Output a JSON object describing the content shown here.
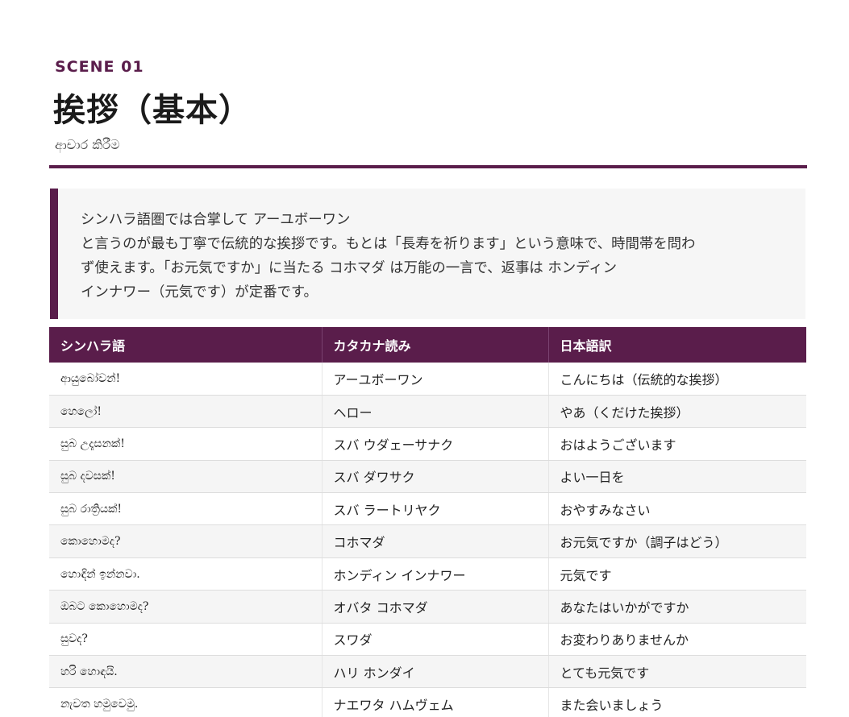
{
  "header": {
    "scene": "SCENE  01",
    "title": "挨拶（基本）",
    "subtitle": "ආචාර කිරීම"
  },
  "note": {
    "lines": [
      "シンハラ語圏では合掌して アーユボーワン",
      "と言うのが最も丁寧で伝統的な挨拶です。もとは「長寿を祈ります」という意味で、時間帯を問わ",
      "ず使えます。「お元気ですか」に当たる コホマダ は万能の一言で、返事は ホンディン",
      "インナワー（元気です）が定番です。"
    ]
  },
  "table": {
    "headers": [
      "シンハラ語",
      "カタカナ読み",
      "日本語訳"
    ],
    "rows": [
      [
        "ආයුබෝවන්!",
        "アーユボーワン",
        "こんにちは（伝統的な挨拶）"
      ],
      [
        "හෙලෝ!",
        "ヘロー",
        "やあ（くだけた挨拶）"
      ],
      [
        "සුබ උදෑසනක්!",
        "スバ ウダェーサナク",
        "おはようございます"
      ],
      [
        "සුබ දවසක්!",
        "スバ ダワサク",
        "よい一日を"
      ],
      [
        "සුබ රාත්‍රියක්!",
        "スバ ラートリヤク",
        "おやすみなさい"
      ],
      [
        "කොහොමද?",
        "コホマダ",
        "お元気ですか（調子はどう）"
      ],
      [
        "හොඳින් ඉන්නවා.",
        "ホンディン インナワー",
        "元気です"
      ],
      [
        "ඔබට කොහොමද?",
        "オバタ コホマダ",
        "あなたはいかがですか"
      ],
      [
        "සුවද?",
        "スワダ",
        "お変わりありませんか"
      ],
      [
        "හරි හොඳයි.",
        "ハリ ホンダイ",
        "とても元気です"
      ],
      [
        "නැවත හමුවෙමු.",
        "ナエワタ ハムヴェム",
        "また会いましょう"
      ]
    ]
  }
}
